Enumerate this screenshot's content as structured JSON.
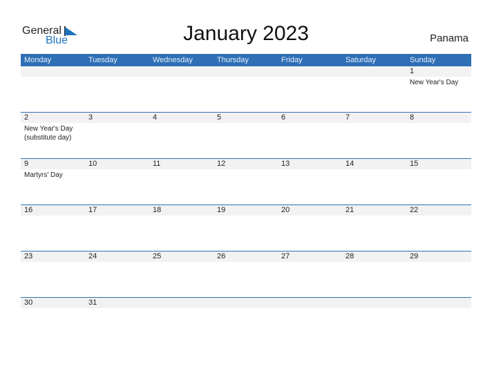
{
  "logo": {
    "general": "General",
    "blue": "Blue"
  },
  "title": "January 2023",
  "country": "Panama",
  "colors": {
    "accent": "#2e6fb5",
    "band": "#f2f2f2"
  },
  "days": [
    "Monday",
    "Tuesday",
    "Wednesday",
    "Thursday",
    "Friday",
    "Saturday",
    "Sunday"
  ],
  "weeks": [
    [
      {
        "d": ""
      },
      {
        "d": ""
      },
      {
        "d": ""
      },
      {
        "d": ""
      },
      {
        "d": ""
      },
      {
        "d": ""
      },
      {
        "d": "1",
        "e": "New Year's Day"
      }
    ],
    [
      {
        "d": "2",
        "e": "New Year's Day (substitute day)"
      },
      {
        "d": "3"
      },
      {
        "d": "4"
      },
      {
        "d": "5"
      },
      {
        "d": "6"
      },
      {
        "d": "7"
      },
      {
        "d": "8"
      }
    ],
    [
      {
        "d": "9",
        "e": "Martyrs' Day"
      },
      {
        "d": "10"
      },
      {
        "d": "11"
      },
      {
        "d": "12"
      },
      {
        "d": "13"
      },
      {
        "d": "14"
      },
      {
        "d": "15"
      }
    ],
    [
      {
        "d": "16"
      },
      {
        "d": "17"
      },
      {
        "d": "18"
      },
      {
        "d": "19"
      },
      {
        "d": "20"
      },
      {
        "d": "21"
      },
      {
        "d": "22"
      }
    ],
    [
      {
        "d": "23"
      },
      {
        "d": "24"
      },
      {
        "d": "25"
      },
      {
        "d": "26"
      },
      {
        "d": "27"
      },
      {
        "d": "28"
      },
      {
        "d": "29"
      }
    ],
    [
      {
        "d": "30"
      },
      {
        "d": "31"
      },
      {
        "d": ""
      },
      {
        "d": ""
      },
      {
        "d": ""
      },
      {
        "d": ""
      },
      {
        "d": ""
      }
    ]
  ]
}
